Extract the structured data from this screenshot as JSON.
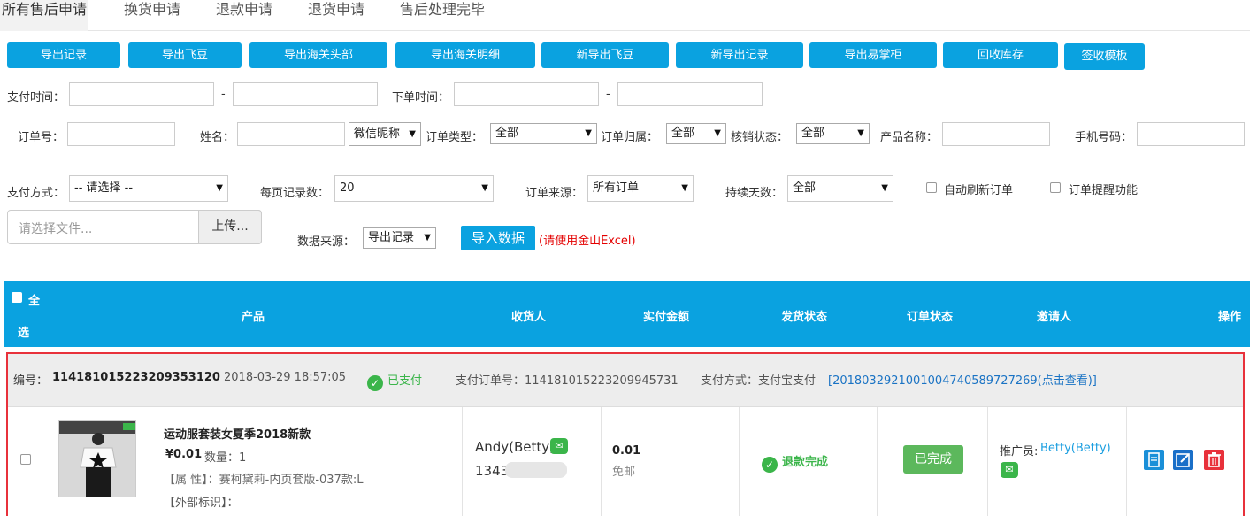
{
  "tabs": [
    "所有售后申请",
    "换货申请",
    "退款申请",
    "退货申请",
    "售后处理完毕"
  ],
  "toolbar": [
    "导出记录",
    "导出飞豆",
    "导出海关头部",
    "导出海关明细",
    "新导出飞豆",
    "新导出记录",
    "导出易掌柜",
    "回收库存",
    "签收模板"
  ],
  "filters": {
    "pay_time": "支付时间：",
    "order_time": "下单时间：",
    "dash": "-",
    "order_no": "订单号：",
    "name": "姓名：",
    "name_select": "微信昵称",
    "order_type": "订单类型：",
    "order_type_val": "全部",
    "order_owner": "订单归属：",
    "order_owner_val": "全部",
    "verify_status": "核销状态：",
    "verify_status_val": "全部",
    "product_name": "产品名称：",
    "phone": "手机号码：",
    "pay_method": "支付方式：",
    "pay_method_val": "-- 请选择 --",
    "per_page": "每页记录数：",
    "per_page_val": "20",
    "order_source": "订单来源：",
    "order_source_val": "所有订单",
    "duration": "持续天数：",
    "duration_val": "全部",
    "auto_refresh": "自动刷新订单",
    "order_remind": "订单提醒功能"
  },
  "upload": {
    "placeholder": "请选择文件...",
    "button": "上传...",
    "data_source": "数据来源：",
    "data_source_val": "导出记录",
    "import": "导入数据",
    "note": "(请使用金山Excel)"
  },
  "table": {
    "select_all_1": "全",
    "select_all_2": "选",
    "headers": [
      "产品",
      "收货人",
      "实付金额",
      "发货状态",
      "订单状态",
      "邀请人",
      "操作"
    ]
  },
  "order": {
    "no_label": "编号：",
    "no": "114181015223209353120",
    "time": "2018-03-29 18:57:05",
    "paid": "已支付",
    "pay_order": "支付订单号：114181015223209945731",
    "pay_method": "支付方式：支付宝支付",
    "pay_link": "[2018032921001004740589727269(点击查看)]",
    "product": "运动服套装女夏季2018新款",
    "price": "¥0.01",
    "qty": "数量：1",
    "attr": "【属 性】：赛柯黛莉-内页套版-037款:L",
    "ext": "【外部标识】：",
    "receiver": "Andy(Betty)",
    "phone": "1343",
    "amount": "0.01",
    "shipping": "免邮",
    "ship_status": "退款完成",
    "order_status": "已完成",
    "promoter_label": "推广员:",
    "promoter": "Betty(Betty)"
  },
  "colors": {
    "accent": "#0aa2e0",
    "success": "#3bb54a",
    "danger": "#e8313b",
    "link": "#1a73c4"
  }
}
